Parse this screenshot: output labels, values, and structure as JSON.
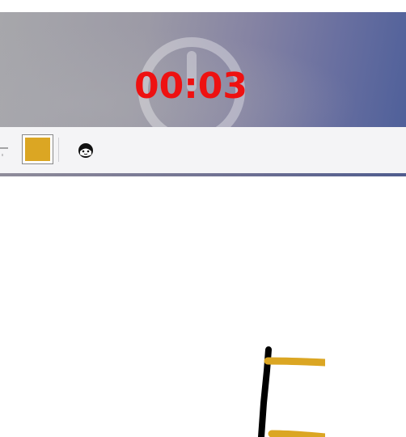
{
  "banner": {
    "timer_text": "00:03",
    "timer_color": "#ee1111",
    "icon": "power-icon"
  },
  "toolbar": {
    "selected_color": "#dba623",
    "face_icon": "face-icon",
    "line_tool_icon": "line-tool-icon"
  },
  "canvas": {
    "stroke_colors": [
      "#000000",
      "#dba623"
    ]
  }
}
